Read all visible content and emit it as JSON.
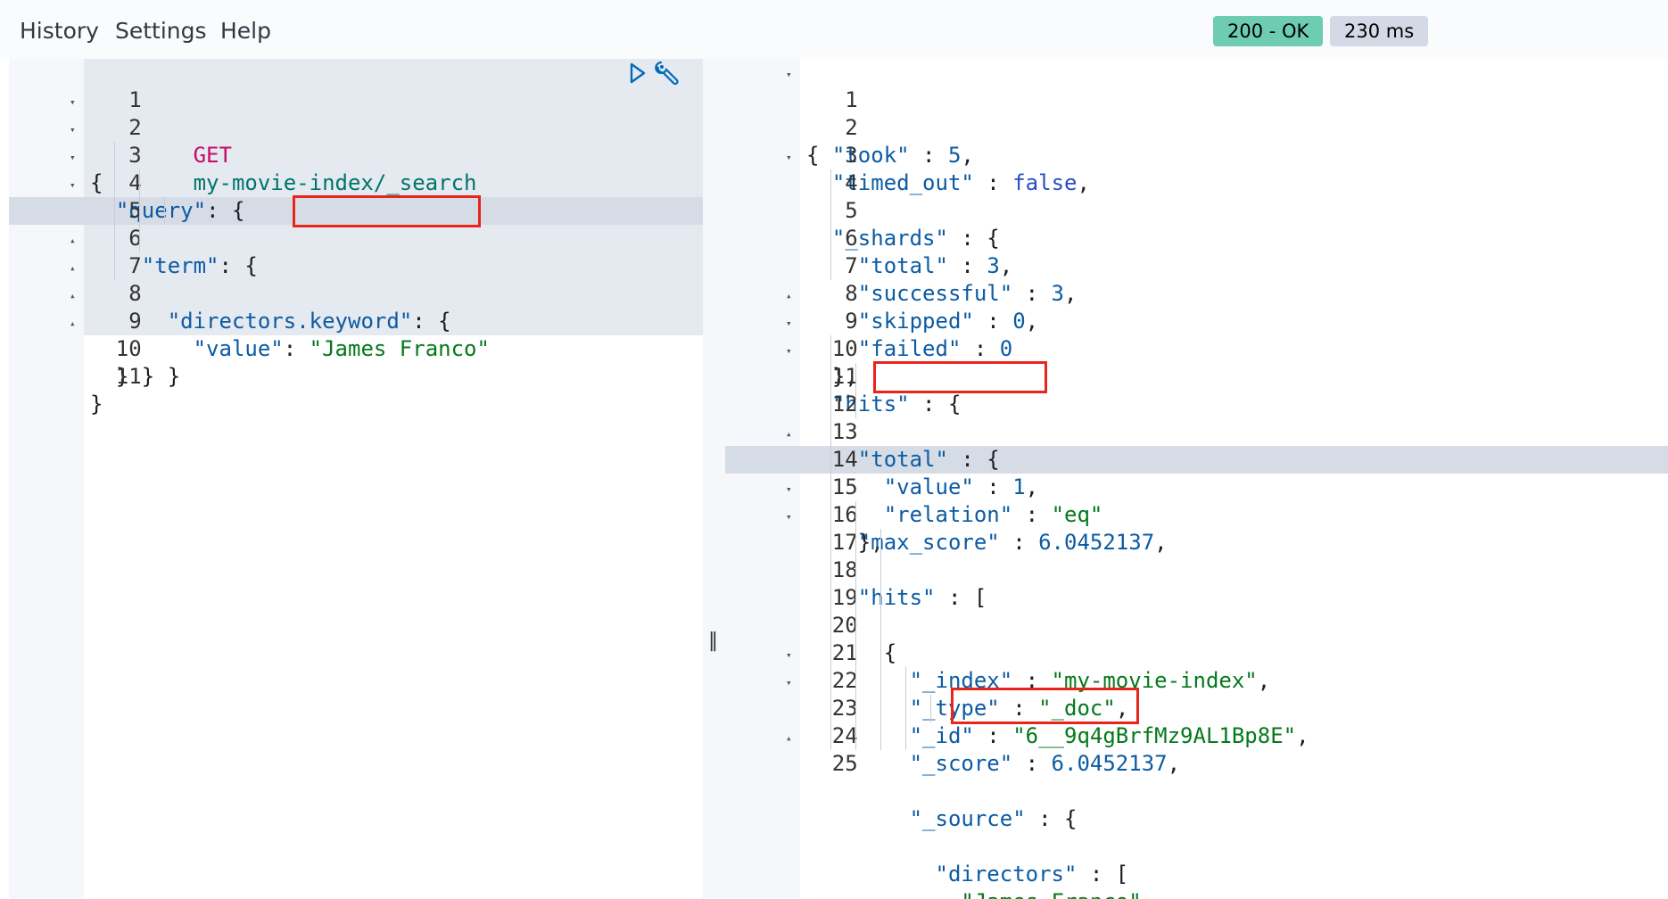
{
  "menu": {
    "history": "History",
    "settings": "Settings",
    "help": "Help"
  },
  "status": {
    "code": "200 - OK",
    "time": "230 ms"
  },
  "request": {
    "method": "GET",
    "url": "my-movie-index/_search",
    "line_numbers": [
      "1",
      "2",
      "3",
      "4",
      "5",
      "6",
      "7",
      "8",
      "9",
      "10",
      "11"
    ],
    "lines": [
      {
        "key": "\"query\"",
        "rest": ": {"
      },
      {
        "key": "\"term\"",
        "rest": ": {"
      },
      {
        "key": "\"directors.keyword\"",
        "rest": ": {"
      },
      {
        "key": "\"value\"",
        "rest": ": ",
        "str": "\"James Franco\""
      }
    ],
    "open_brace": "{",
    "close_brace": "}"
  },
  "response": {
    "line_numbers": [
      "1",
      "2",
      "3",
      "4",
      "5",
      "6",
      "7",
      "8",
      "9",
      "10",
      "11",
      "12",
      "13",
      "14",
      "15",
      "16",
      "17",
      "18",
      "19",
      "20",
      "21",
      "22",
      "23",
      "24",
      "25"
    ],
    "took_key": "\"took\"",
    "took_val": "5",
    "timed_out_key": "\"timed_out\"",
    "timed_out_val": "false",
    "shards_key": "\"_shards\"",
    "total_key": "\"total\"",
    "total_val": "3",
    "successful_key": "\"successful\"",
    "successful_val": "3",
    "skipped_key": "\"skipped\"",
    "skipped_val": "0",
    "failed_key": "\"failed\"",
    "failed_val": "0",
    "hits_key": "\"hits\"",
    "value_key": "\"value\"",
    "value_val": "1",
    "relation_key": "\"relation\"",
    "relation_val": "\"eq\"",
    "max_score_key": "\"max_score\"",
    "max_score_val": "6.0452137",
    "index_key": "\"_index\"",
    "index_val": "\"my-movie-index\"",
    "type_key": "\"_type\"",
    "type_val": "\"_doc\"",
    "id_key": "\"_id\"",
    "id_val": "\"6__9q4gBrfMz9AL1Bp8E\"",
    "score_key": "\"_score\"",
    "score_val": "6.0452137",
    "source_key": "\"_source\"",
    "directors_key": "\"directors\"",
    "director_val": "\"James Franco\""
  },
  "icons": [
    "play-icon",
    "wrench-icon",
    "fold-arrow-icon",
    "resize-handle-icon"
  ],
  "colors": {
    "ok_badge": "#6dccb1",
    "time_badge": "#d3dae6",
    "highlight_box": "#e8241b",
    "string": "#05791a",
    "key": "#0b5ba3",
    "method": "#c80a68"
  }
}
